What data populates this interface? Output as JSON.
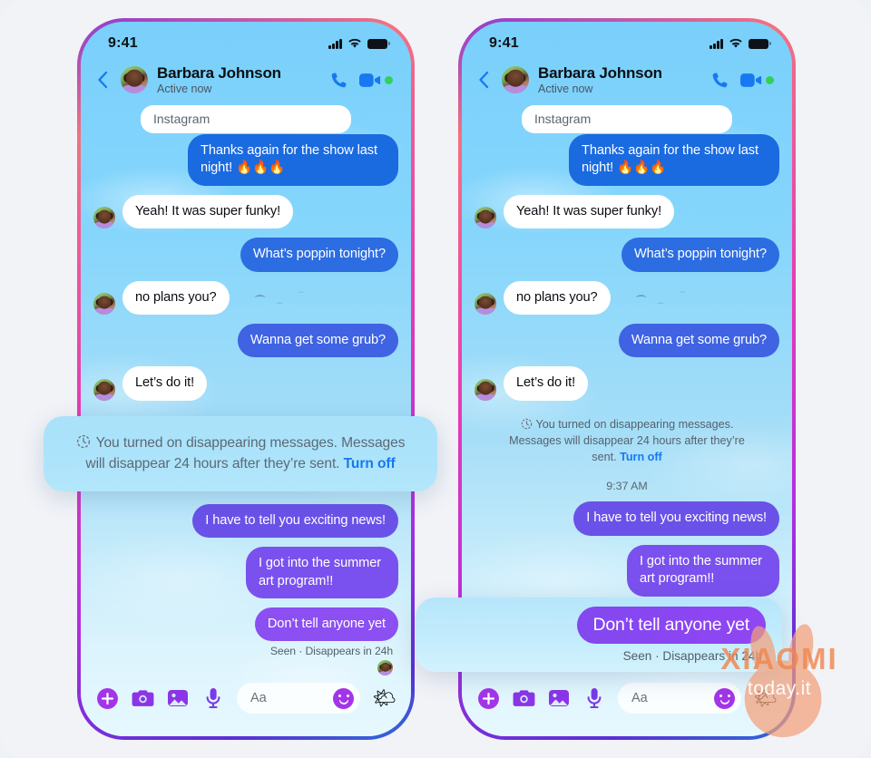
{
  "page": {
    "background_color": "#f1f3f7",
    "accent_blue": "#1878f2",
    "accent_purple": "#8b4ff2",
    "bubble_blue": "#1a6ae0",
    "bubble_purple": "#7a51ee"
  },
  "phones": [
    {
      "id": "left-phone",
      "status_bar": {
        "time": "9:41",
        "signal": "signal-bars-icon",
        "wifi": "wifi-icon",
        "battery": "battery-full-icon"
      },
      "header": {
        "back": "back-chevron-icon",
        "avatar": "contact-avatar",
        "name": "Barbara Johnson",
        "status": "Active now",
        "call": "phone-call-icon",
        "video": "video-camera-icon",
        "presence": "active-green-dot"
      },
      "partial_card": {
        "text": "Instagram"
      },
      "messages": [
        {
          "side": "out",
          "tone": "b-blue1",
          "text": "Thanks again for the show last night! 🔥🔥🔥"
        },
        {
          "side": "in",
          "tone": "in",
          "text": "Yeah! It was super funky!"
        },
        {
          "side": "out",
          "tone": "b-blue2",
          "text": "What’s poppin tonight?"
        },
        {
          "side": "in",
          "tone": "in",
          "text": "no plans you?"
        },
        {
          "side": "out",
          "tone": "b-blue3",
          "text": "Wanna get some grub?"
        },
        {
          "side": "in",
          "tone": "in",
          "text": "Let’s do it!"
        }
      ],
      "messages_after": [
        {
          "side": "out",
          "tone": "b-purp1",
          "text": "I have to tell you exciting news!"
        },
        {
          "side": "out",
          "tone": "b-purp2",
          "text": "I got into the summer art program!!"
        },
        {
          "side": "out",
          "tone": "b-purp3",
          "text": "Don’t tell anyone yet"
        }
      ],
      "seen_status": "Seen · Disappears in 24h",
      "composer": {
        "add": "plus-circle-icon",
        "camera": "camera-icon",
        "gallery": "photo-gallery-icon",
        "mic": "microphone-icon",
        "placeholder": "Aa",
        "emoji": "emoji-smiley-icon",
        "sticker": "weather-sticker-icon"
      }
    },
    {
      "id": "right-phone",
      "status_bar": {
        "time": "9:41",
        "signal": "signal-bars-icon",
        "wifi": "wifi-icon",
        "battery": "battery-full-icon"
      },
      "header": {
        "back": "back-chevron-icon",
        "avatar": "contact-avatar",
        "name": "Barbara Johnson",
        "status": "Active now",
        "call": "phone-call-icon",
        "video": "video-camera-icon",
        "presence": "active-green-dot"
      },
      "partial_card": {
        "text": "Instagram"
      },
      "messages": [
        {
          "side": "out",
          "tone": "b-blue1",
          "text": "Thanks again for the show last night! 🔥🔥🔥"
        },
        {
          "side": "in",
          "tone": "in",
          "text": "Yeah! It was super funky!"
        },
        {
          "side": "out",
          "tone": "b-blue2",
          "text": "What’s poppin tonight?"
        },
        {
          "side": "in",
          "tone": "in",
          "text": "no plans you?"
        },
        {
          "side": "out",
          "tone": "b-blue3",
          "text": "Wanna get some grub?"
        },
        {
          "side": "in",
          "tone": "in",
          "text": "Let’s do it!"
        }
      ],
      "system_notice": {
        "icon": "disappearing-timer-icon",
        "text": "You turned on disappearing messages. Messages will disappear 24 hours after they’re sent.",
        "action": "Turn off"
      },
      "timestamp": "9:37 AM",
      "messages_after": [
        {
          "side": "out",
          "tone": "b-purp1",
          "text": "I have to tell you exciting news!"
        },
        {
          "side": "out",
          "tone": "b-purp2",
          "text": "I got into the summer art program!!"
        },
        {
          "side": "out",
          "tone": "b-purp3",
          "text": "Don’t tell anyone yet"
        }
      ],
      "seen_status": "Seen · Disappears in 24h",
      "composer": {
        "add": "plus-circle-icon",
        "camera": "camera-icon",
        "gallery": "photo-gallery-icon",
        "mic": "microphone-icon",
        "placeholder": "Aa",
        "emoji": "emoji-smiley-icon",
        "sticker": "weather-sticker-icon"
      }
    }
  ],
  "callouts": {
    "left": {
      "icon": "disappearing-timer-icon",
      "line1": "You turned on disappearing messages. Messages",
      "line2": "will disappear 24 hours after they’re sent.",
      "action": "Turn off"
    },
    "right": {
      "bubble": "Don’t tell anyone yet",
      "seen": "Seen · Disappears in 24h"
    }
  },
  "watermark": {
    "brand": "XIAOMI",
    "domain": "today.it",
    "mascot": "bunny-mascot-icon"
  }
}
